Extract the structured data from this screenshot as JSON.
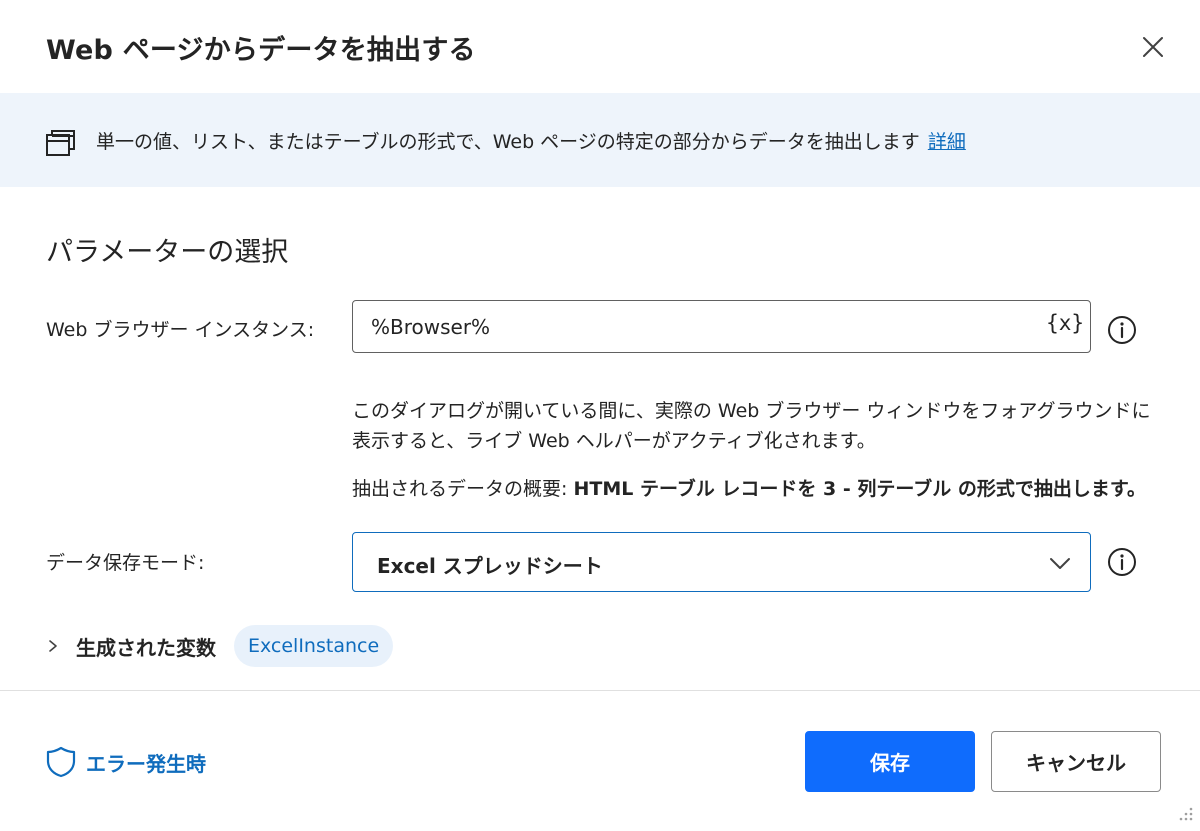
{
  "dialog": {
    "title": "Web ページからデータを抽出する"
  },
  "banner": {
    "text": "単一の値、リスト、またはテーブルの形式で、Web ページの特定の部分からデータを抽出します",
    "link": "詳細"
  },
  "parameters": {
    "section_title": "パラメーターの選択",
    "browser": {
      "label": "Web ブラウザー インスタンス:",
      "value": "%Browser%",
      "var_button": "{x}"
    },
    "hint_line1": "このダイアログが開いている間に、実際の Web ブラウザー ウィンドウをフォアグラウンドに表示すると、ライブ Web ヘルパーがアクティブ化されます。",
    "summary_prefix": "抽出されるデータの概要: ",
    "summary_bold": "HTML テーブル レコードを 3 - 列テーブル の形式で抽出します。",
    "mode": {
      "label": "データ保存モード:",
      "value": "Excel スプレッドシート"
    }
  },
  "generated": {
    "label": "生成された変数",
    "variable": "ExcelInstance"
  },
  "footer": {
    "error_label": "エラー発生時",
    "save_label": "保存",
    "cancel_label": "キャンセル"
  },
  "icons": {
    "close": "close-icon",
    "banner": "window-stack-icon",
    "info": "info-icon",
    "chevron_down": "chevron-down-icon",
    "chevron_right": "chevron-right-icon",
    "shield": "shield-icon",
    "resize": "resize-grip-icon"
  },
  "colors": {
    "accent": "#0f6cbd",
    "primary_button": "#0f6cfd",
    "banner_bg": "#eef4fb",
    "pill_bg": "#e8f1fb"
  }
}
